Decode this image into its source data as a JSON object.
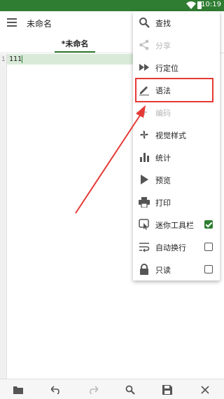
{
  "status_bar": {
    "time": "10:19"
  },
  "app_bar": {
    "title": "未命名"
  },
  "tabs": [
    {
      "label": "*未命名",
      "active": true
    }
  ],
  "editor": {
    "line_numbers": [
      "1"
    ],
    "lines": [
      "111"
    ]
  },
  "menu": {
    "items": [
      {
        "label": "查找",
        "icon": "search-icon",
        "enabled": true
      },
      {
        "label": "分享",
        "icon": "share-icon",
        "enabled": false
      },
      {
        "label": "行定位",
        "icon": "goto-line-icon",
        "enabled": true
      },
      {
        "label": "语法",
        "icon": "syntax-pen-icon",
        "enabled": true
      },
      {
        "label": "编码",
        "icon": "encoding-icon",
        "enabled": false
      },
      {
        "label": "视觉样式",
        "icon": "theme-fan-icon",
        "enabled": true
      },
      {
        "label": "统计",
        "icon": "bar-chart-icon",
        "enabled": true
      },
      {
        "label": "预览",
        "icon": "play-icon",
        "enabled": true
      },
      {
        "label": "打印",
        "icon": "printer-icon",
        "enabled": true
      },
      {
        "label": "迷你工具栏",
        "icon": "mini-toolbar-icon",
        "enabled": true,
        "checked": true
      },
      {
        "label": "自动换行",
        "icon": "word-wrap-icon",
        "enabled": true,
        "checked": false
      },
      {
        "label": "只读",
        "icon": "lock-icon",
        "enabled": true,
        "checked": false
      }
    ]
  },
  "bottom_toolbar": [
    "folder-icon",
    "undo-icon",
    "redo-icon",
    "search-icon",
    "save-icon",
    "close-icon"
  ],
  "colors": {
    "accent": "#2f7d32",
    "annotation": "#e53935",
    "line_highlight": "#d9ead9"
  }
}
